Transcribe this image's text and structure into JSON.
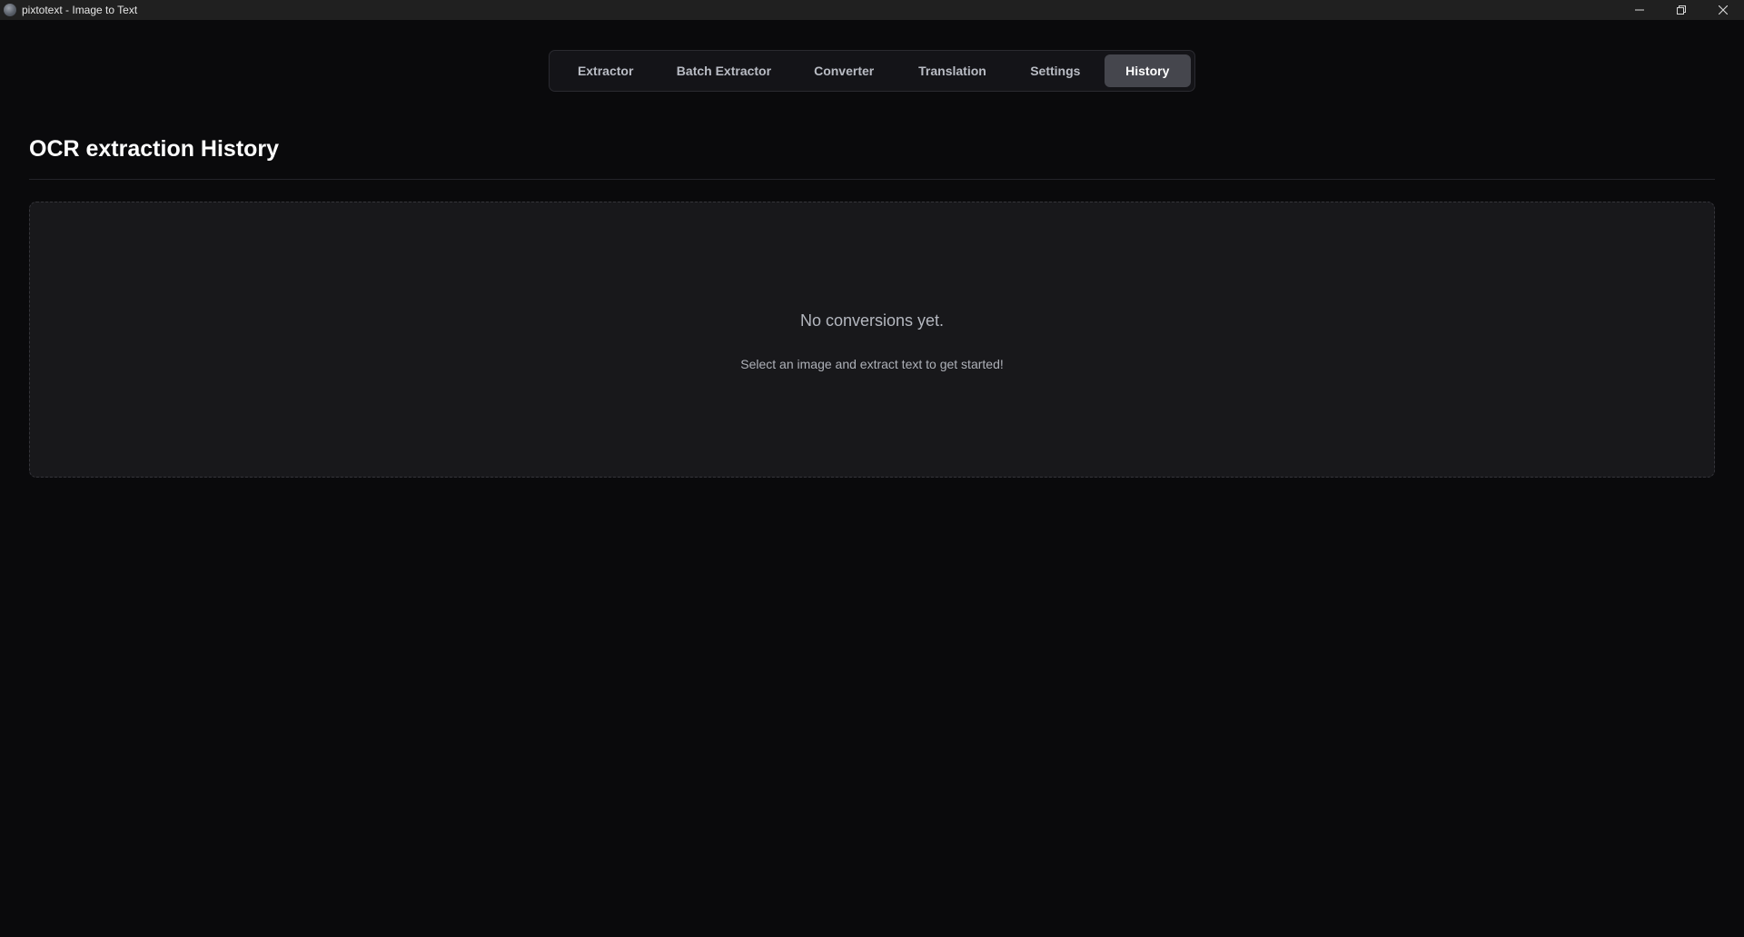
{
  "window": {
    "title": "pixtotext - Image to Text",
    "controls": [
      "minimize-icon",
      "restore-icon",
      "close-icon"
    ]
  },
  "tabs": [
    {
      "label": "Extractor",
      "active": false
    },
    {
      "label": "Batch Extractor",
      "active": false
    },
    {
      "label": "Converter",
      "active": false
    },
    {
      "label": "Translation",
      "active": false
    },
    {
      "label": "Settings",
      "active": false
    },
    {
      "label": "History",
      "active": true
    }
  ],
  "page": {
    "title": "OCR extraction History"
  },
  "empty_state": {
    "title": "No conversions yet.",
    "subtitle": "Select an image and extract text to get started!"
  },
  "colors": {
    "background": "#0a0a0c",
    "panel": "#18181b",
    "active_tab": "#45464d",
    "titlebar": "#202020"
  }
}
